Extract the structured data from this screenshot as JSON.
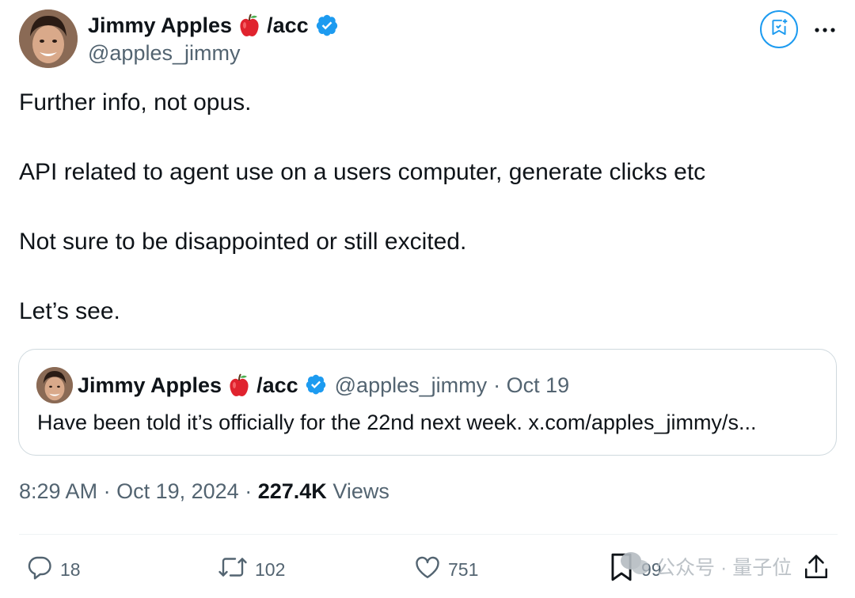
{
  "author": {
    "name": "Jimmy Apples",
    "suffix": "/acc",
    "handle": "@apples_jimmy"
  },
  "icons": {
    "avatar": "profile-photo",
    "apple": "red-apple-emoji",
    "verified": "verified-badge-icon",
    "grok": "grok-icon",
    "more": "more-icon",
    "reply": "reply-icon",
    "retweet": "retweet-icon",
    "like": "heart-icon",
    "bookmark": "bookmark-icon",
    "share": "share-icon"
  },
  "tweet": {
    "paragraphs": [
      "Further info, not opus.",
      "API related to agent use on a users computer, generate clicks etc",
      "Not sure to be disappointed or still excited.",
      "Let’s see."
    ]
  },
  "quote": {
    "name": "Jimmy Apples",
    "suffix": "/acc",
    "handle": "@apples_jimmy",
    "date": "· Oct 19",
    "text": "Have been told it’s officially for the 22nd next week. x.com/apples_jimmy/s..."
  },
  "meta": {
    "time": "8:29 AM",
    "separator": "·",
    "date": "Oct 19, 2024",
    "views_count": "227.4K",
    "views_label": "Views"
  },
  "actions": {
    "replies": "18",
    "retweets": "102",
    "likes": "751",
    "bookmarks": "99"
  },
  "watermark": {
    "text": "公众号 · 量子位"
  },
  "colors": {
    "text": "#0f1419",
    "secondary": "#536471",
    "accent": "#1d9bf0",
    "border": "#cfd9de"
  }
}
